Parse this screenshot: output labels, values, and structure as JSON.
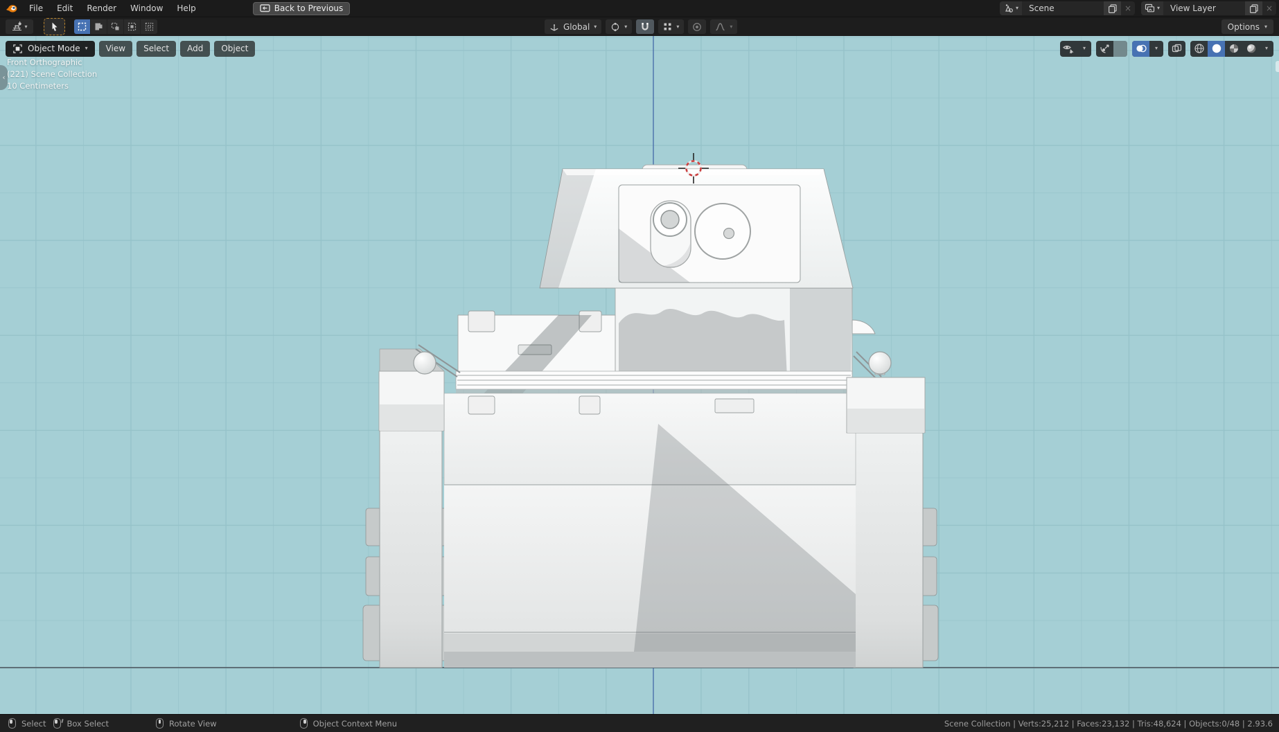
{
  "topbar": {
    "menus": [
      {
        "label": "File"
      },
      {
        "label": "Edit"
      },
      {
        "label": "Render"
      },
      {
        "label": "Window"
      },
      {
        "label": "Help"
      }
    ],
    "back_button_label": "Back to Previous",
    "scene_selector": {
      "value": "Scene"
    },
    "view_layer_selector": {
      "value": "View Layer"
    }
  },
  "toolbar": {
    "orientation_label": "Global",
    "options_label": "Options"
  },
  "viewport": {
    "header": {
      "mode_label": "Object Mode",
      "menus": [
        {
          "label": "View"
        },
        {
          "label": "Select"
        },
        {
          "label": "Add"
        },
        {
          "label": "Object"
        }
      ]
    },
    "overlay": {
      "line1": "Front Orthographic",
      "line2": "(221) Scene Collection",
      "line3": "10 Centimeters"
    }
  },
  "statusbar": {
    "hints": [
      {
        "label": "Select"
      },
      {
        "label": "Box Select"
      },
      {
        "label": "Rotate View"
      },
      {
        "label": "Object Context Menu"
      }
    ],
    "stats": "Scene Collection | Verts:25,212 | Faces:23,132 | Tris:48,624 | Objects:0/48 | 2.93.6"
  },
  "icons": {
    "chevron_down": "▾",
    "close": "×",
    "collapse_left": "‹"
  },
  "colors": {
    "accent": "#4772b3",
    "viewport_bg": "#a5cfd5",
    "grid_line": "#95c2c9",
    "z_axis": "#3e63a6",
    "horizon": "#546068",
    "tool_border": "#b9842d"
  }
}
